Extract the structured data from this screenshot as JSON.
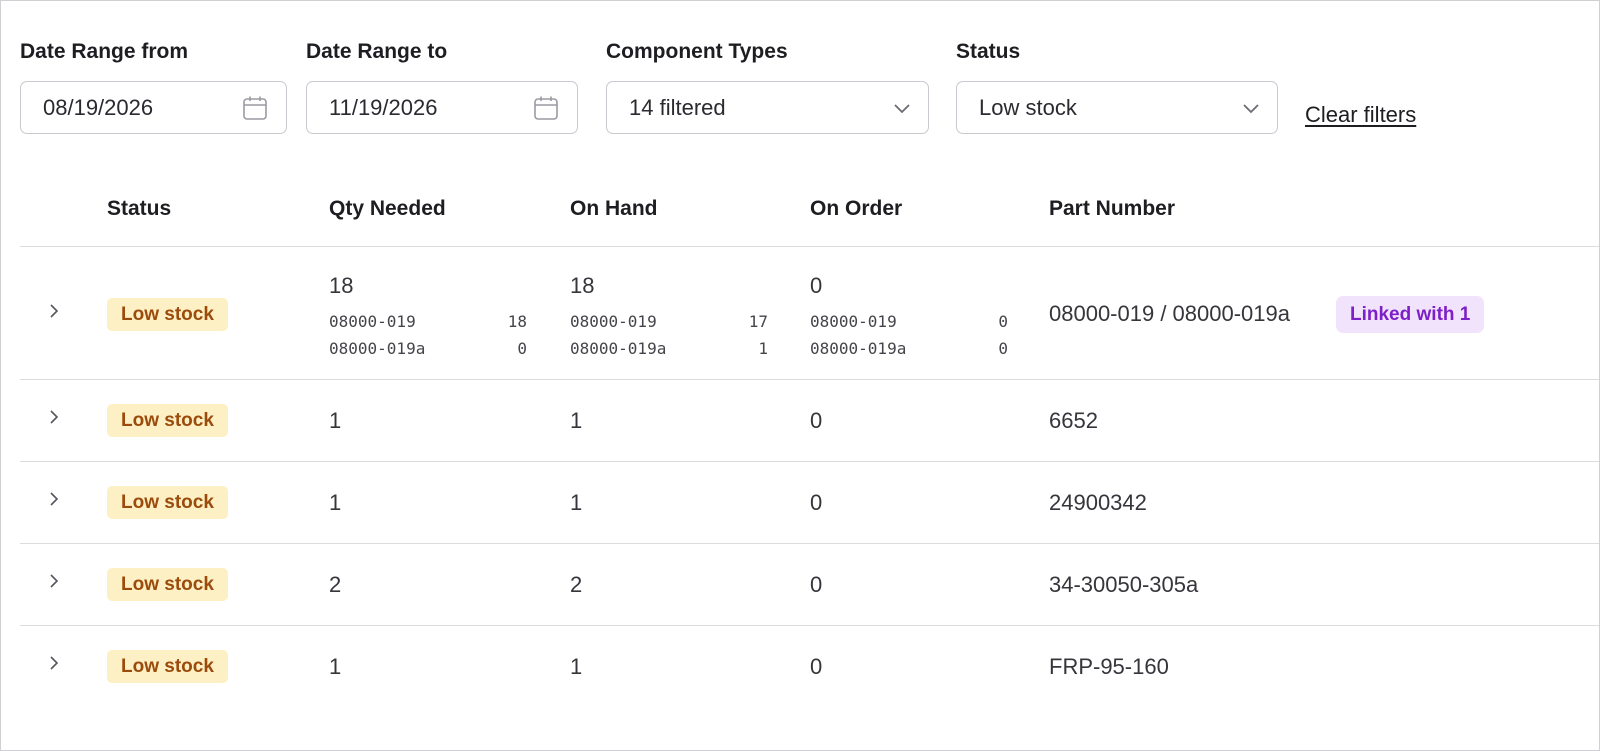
{
  "filters": {
    "date_from": {
      "label": "Date Range from",
      "value": "08/19/2026",
      "icon": "calendar-icon"
    },
    "date_to": {
      "label": "Date Range to",
      "value": "11/19/2026",
      "icon": "calendar-icon"
    },
    "component_types": {
      "label": "Component Types",
      "value": "14 filtered",
      "icon": "chevron-down-icon"
    },
    "status": {
      "label": "Status",
      "value": "Low stock",
      "icon": "chevron-down-icon"
    },
    "clear_label": "Clear filters"
  },
  "table": {
    "columns": [
      "Status",
      "Qty Needed",
      "On Hand",
      "On Order",
      "Part Number"
    ],
    "rows": [
      {
        "status": "Low stock",
        "qty_needed": "18",
        "on_hand": "18",
        "on_order": "0",
        "part_number": "08000-019 / 08000-019a",
        "linked_label": "Linked with 1",
        "breakdown": {
          "qty_needed": [
            {
              "part": "08000-019",
              "qty": "18"
            },
            {
              "part": "08000-019a",
              "qty": "0"
            }
          ],
          "on_hand": [
            {
              "part": "08000-019",
              "qty": "17"
            },
            {
              "part": "08000-019a",
              "qty": "1"
            }
          ],
          "on_order": [
            {
              "part": "08000-019",
              "qty": "0"
            },
            {
              "part": "08000-019a",
              "qty": "0"
            }
          ]
        }
      },
      {
        "status": "Low stock",
        "qty_needed": "1",
        "on_hand": "1",
        "on_order": "0",
        "part_number": "6652"
      },
      {
        "status": "Low stock",
        "qty_needed": "1",
        "on_hand": "1",
        "on_order": "0",
        "part_number": "24900342"
      },
      {
        "status": "Low stock",
        "qty_needed": "2",
        "on_hand": "2",
        "on_order": "0",
        "part_number": "34-30050-305a"
      },
      {
        "status": "Low stock",
        "qty_needed": "1",
        "on_hand": "1",
        "on_order": "0",
        "part_number": "FRP-95-160"
      }
    ]
  },
  "colors": {
    "badge_bg": "#fdf0c4",
    "badge_text": "#9b4b0c",
    "linked_bg": "#f1e3fb",
    "linked_text": "#7d20c7",
    "border": "#dcdce0"
  }
}
